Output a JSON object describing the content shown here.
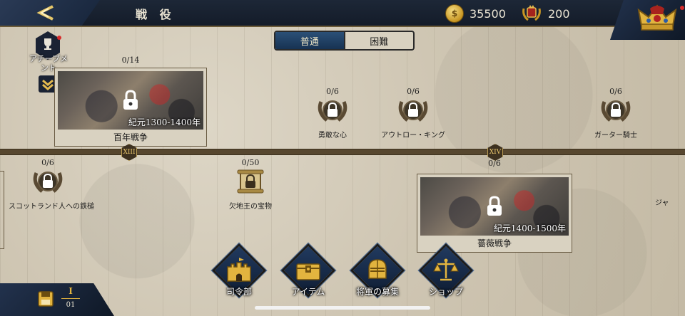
{
  "header": {
    "title": "戦 役",
    "gold": "35500",
    "laurel_points": "200",
    "icons": {
      "back": "back-arrow-icon",
      "gold": "gold-coin-icon",
      "laurel": "laurel-badge-icon",
      "crown": "crown-icon"
    }
  },
  "difficulty": {
    "normal": "普通",
    "hard": "困難",
    "selected": "normal"
  },
  "achievements": {
    "label": "アチーブメント"
  },
  "eras": [
    {
      "count": "0/14",
      "period": "紀元1300-1400年",
      "name": "百年戦争",
      "locked": true
    },
    {
      "count": "0/6",
      "period": "紀元1400-1500年",
      "name": "薔薇戦争",
      "locked": true
    }
  ],
  "timeline_markers": [
    "XIII",
    "XIV"
  ],
  "stages": [
    {
      "count": "0/6",
      "label": "勇敢な心"
    },
    {
      "count": "0/6",
      "label": "アウトロー・キング"
    },
    {
      "count": "0/6",
      "label": "ガーター騎士"
    },
    {
      "count": "0/6",
      "label": "スコットランド人への鉄槌"
    },
    {
      "count": "0/50",
      "label": "欠地王の宝物"
    },
    {
      "count": "",
      "label": "ジャ"
    }
  ],
  "bottom_nav": [
    {
      "label": "司令部",
      "icon": "castle-icon"
    },
    {
      "label": "アイテム",
      "icon": "chest-icon"
    },
    {
      "label": "将軍の募集",
      "icon": "helmet-icon"
    },
    {
      "label": "ショップ",
      "icon": "scales-icon"
    }
  ],
  "page_indicator": {
    "current": "I",
    "total": "01"
  },
  "colors": {
    "navy": "#1a2233",
    "gold": "#c79522",
    "parchment": "#cfc6b3",
    "timeline": "#57472f"
  }
}
